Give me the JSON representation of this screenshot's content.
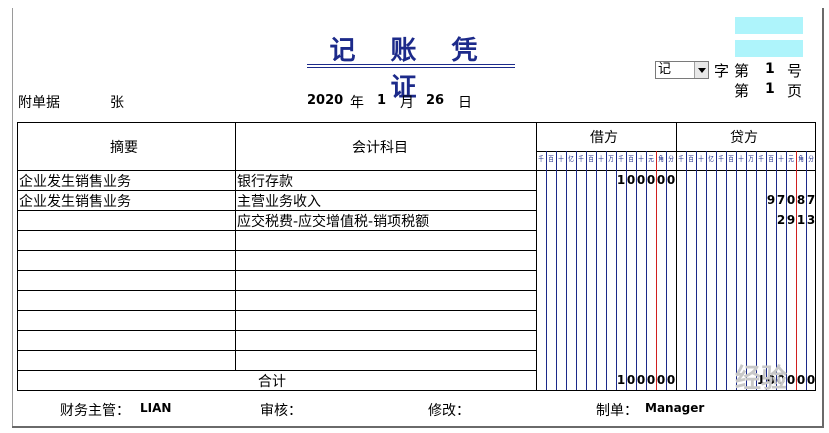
{
  "voucher": {
    "title": "记 账 凭 证",
    "voucher_type": "记",
    "zi_label": "字",
    "di_label": "第",
    "number": "1",
    "hao_label": "号",
    "page": "1",
    "ye_label": "页",
    "attachment_label": "附单据",
    "attachment_unit": "张",
    "date": {
      "year": "2020",
      "year_label": "年",
      "month": "1",
      "month_label": "月",
      "day": "26",
      "day_label": "日"
    }
  },
  "table": {
    "headers": {
      "summary": "摘要",
      "account": "会计科目",
      "debit": "借方",
      "credit": "贷方"
    },
    "units": [
      "千",
      "百",
      "十",
      "亿",
      "千",
      "百",
      "十",
      "万",
      "千",
      "百",
      "十",
      "元",
      "角",
      "分"
    ],
    "rows": [
      {
        "summary": "企业发生销售业务",
        "account": "银行存款",
        "debit": "100000",
        "credit": ""
      },
      {
        "summary": "企业发生销售业务",
        "account": "主营业务收入",
        "debit": "",
        "credit": "97087"
      },
      {
        "summary": "",
        "account": "应交税费-应交增值税-销项税额",
        "debit": "",
        "credit": "2913"
      },
      {
        "summary": "",
        "account": "",
        "debit": "",
        "credit": ""
      },
      {
        "summary": "",
        "account": "",
        "debit": "",
        "credit": ""
      },
      {
        "summary": "",
        "account": "",
        "debit": "",
        "credit": ""
      },
      {
        "summary": "",
        "account": "",
        "debit": "",
        "credit": ""
      },
      {
        "summary": "",
        "account": "",
        "debit": "",
        "credit": ""
      },
      {
        "summary": "",
        "account": "",
        "debit": "",
        "credit": ""
      },
      {
        "summary": "",
        "account": "",
        "debit": "",
        "credit": ""
      }
    ],
    "total_label": "合计",
    "total_debit": "100000",
    "total_credit": "100000"
  },
  "footer": {
    "supervisor_label": "财务主管：",
    "supervisor": "LIAN",
    "review_label": "审核：",
    "modify_label": "修改：",
    "maker_label": "制单：",
    "maker": "Manager"
  },
  "watermark": {
    "text": "经验"
  },
  "colors": {
    "title": "#1c2a8a",
    "digit_divider": "#1c2a8a",
    "decimal_divider": "#d02020",
    "cyan_box": "#aef4fb"
  }
}
